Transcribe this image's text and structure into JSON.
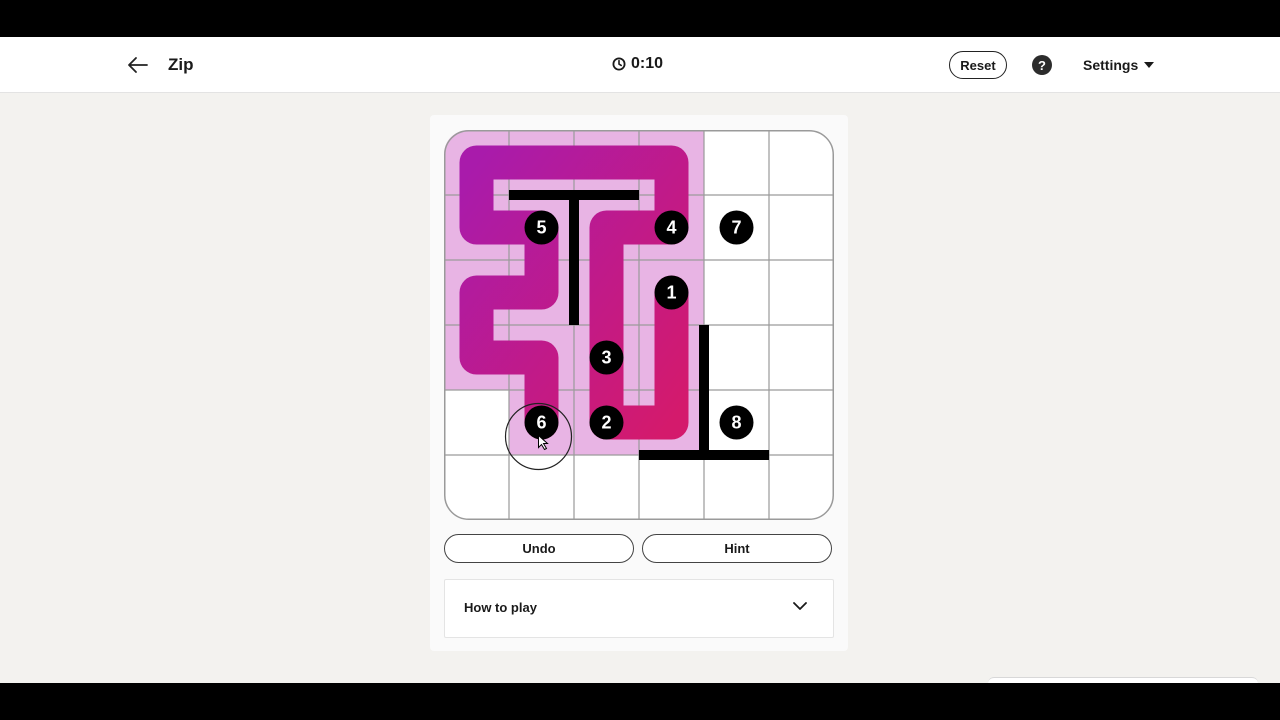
{
  "header": {
    "back_icon": "arrow-left-icon",
    "title": "Zip",
    "timer_icon": "clock-icon",
    "timer": "0:10",
    "reset_label": "Reset",
    "help_icon": "question-icon",
    "help_symbol": "?",
    "settings_label": "Settings",
    "settings_icon": "caret-down-icon"
  },
  "puzzle": {
    "rows": 6,
    "cols": 6,
    "numbers": [
      {
        "value": "1",
        "row": 2,
        "col": 3
      },
      {
        "value": "2",
        "row": 4,
        "col": 2
      },
      {
        "value": "3",
        "row": 3,
        "col": 2
      },
      {
        "value": "4",
        "row": 1,
        "col": 3
      },
      {
        "value": "5",
        "row": 1,
        "col": 1
      },
      {
        "value": "6",
        "row": 4,
        "col": 1
      },
      {
        "value": "7",
        "row": 1,
        "col": 4
      },
      {
        "value": "8",
        "row": 4,
        "col": 4
      }
    ],
    "path": [
      [
        2,
        3
      ],
      [
        3,
        3
      ],
      [
        4,
        3
      ],
      [
        4,
        2
      ],
      [
        3,
        2
      ],
      [
        2,
        2
      ],
      [
        1,
        2
      ],
      [
        1,
        3
      ],
      [
        0,
        3
      ],
      [
        0,
        2
      ],
      [
        0,
        1
      ],
      [
        0,
        0
      ],
      [
        1,
        0
      ],
      [
        1,
        1
      ],
      [
        2,
        1
      ],
      [
        2,
        0
      ],
      [
        3,
        0
      ],
      [
        3,
        1
      ],
      [
        4,
        1
      ]
    ],
    "walls": [
      {
        "type": "h",
        "row": 1,
        "c0": 1,
        "c1": 3
      },
      {
        "type": "v",
        "col": 2,
        "r0": 1,
        "r1": 3
      },
      {
        "type": "v",
        "col": 4,
        "r0": 3,
        "r1": 5
      },
      {
        "type": "h",
        "row": 5,
        "c0": 3,
        "c1": 5
      }
    ],
    "cursor_cell": [
      4,
      1
    ],
    "colors": {
      "path_start": "#a91bab",
      "path_end": "#d41a6c",
      "visited_cell": "#e8b4e4",
      "grid_line": "#9a9a9a",
      "number_bg": "#000000",
      "number_text": "#ffffff",
      "wall": "#000000"
    }
  },
  "controls": {
    "undo_label": "Undo",
    "hint_label": "Hint"
  },
  "how_to_play": {
    "label": "How to play",
    "icon": "chevron-down-icon"
  }
}
